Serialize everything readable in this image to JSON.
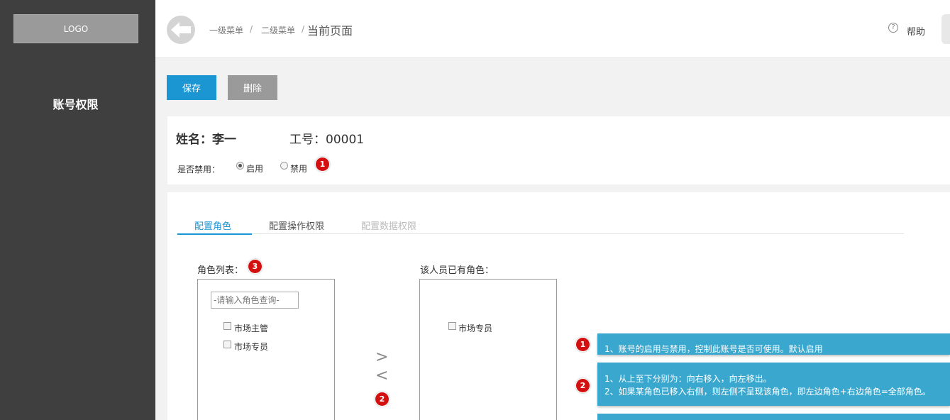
{
  "sidebar": {
    "logo": "LOGO",
    "title": "账号权限"
  },
  "header": {
    "breadcrumb": {
      "level1": "一级菜单",
      "level2": "二级菜单",
      "sep": "/",
      "current": "当前页面"
    },
    "help_icon": "?",
    "help": "帮助"
  },
  "toolbar": {
    "save_label": "保存",
    "delete_label": "删除"
  },
  "user": {
    "name": "姓名：李一",
    "employee_id": "工号：00001",
    "disable_label": "是否禁用：",
    "options": [
      "启用",
      "禁用"
    ],
    "selected": "启用"
  },
  "tabs": [
    {
      "label": "配置角色",
      "state": "active"
    },
    {
      "label": "配置操作权限",
      "state": "normal"
    },
    {
      "label": "配置数据权限",
      "state": "disabled"
    }
  ],
  "role_list": {
    "title": "角色列表：",
    "search_placeholder": "-请输入角色查询-",
    "items": [
      "市场主管",
      "市场专员"
    ]
  },
  "transfer": {
    "move_right": ">",
    "move_left": "<"
  },
  "assigned_roles": {
    "title": "该人员已有角色：",
    "items": [
      "市场专员"
    ]
  },
  "badges": [
    "1",
    "2",
    "3"
  ],
  "notes": [
    {
      "number": "1",
      "lines": [
        "1、账号的启用与禁用，控制此账号是否可使用。默认启用"
      ]
    },
    {
      "number": "2",
      "lines": [
        "1、从上至下分别为：向右移入，向左移出。",
        "2、如果某角色已移入右侧，则左侧不呈现该角色，即左边角色+右边角色=全部角色。"
      ]
    }
  ],
  "colors": {
    "accent": "#1b96d2",
    "sidebar": "#3f3f3f",
    "note": "#3aa7cf",
    "badge": "#d30f0f"
  }
}
